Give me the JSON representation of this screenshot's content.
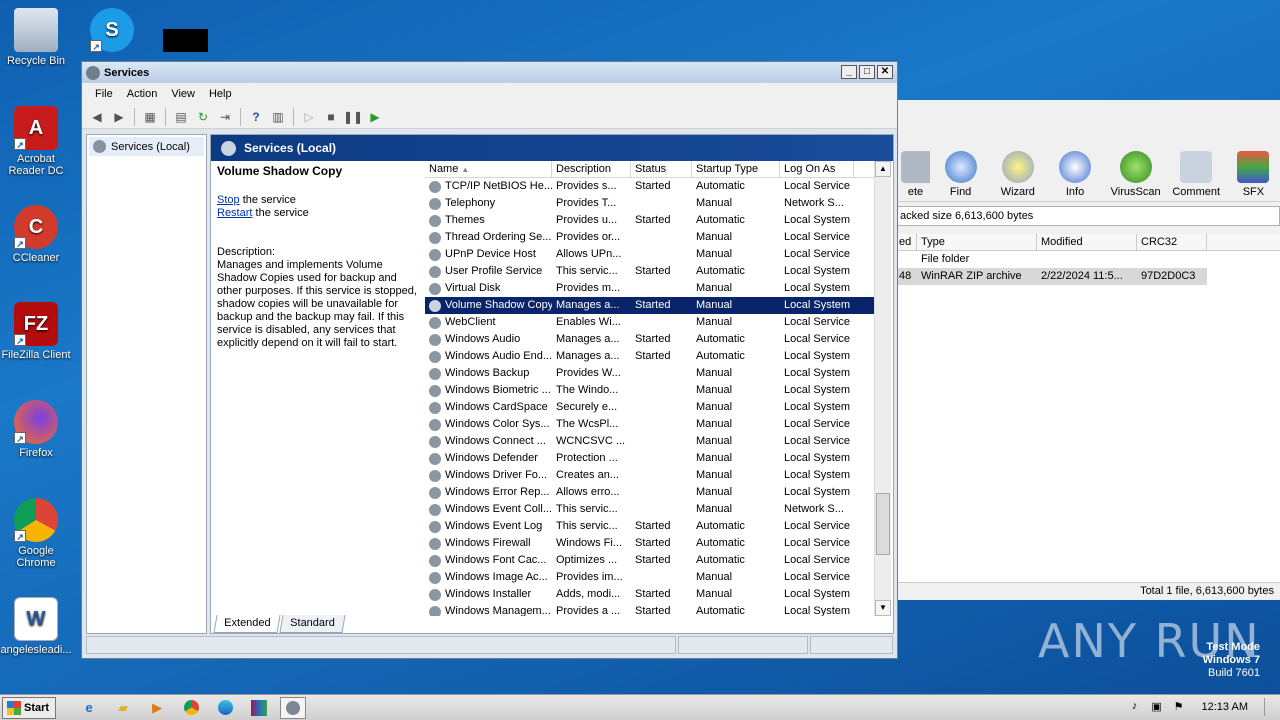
{
  "desktop": {
    "icons": [
      {
        "label": "Recycle Bin",
        "icon": "recycle-bin-icon"
      },
      {
        "label": "Acrobat Reader DC",
        "icon": "acrobat-icon"
      },
      {
        "label": "CCleaner",
        "icon": "ccleaner-icon"
      },
      {
        "label": "FileZilla Client",
        "icon": "filezilla-icon"
      },
      {
        "label": "Firefox",
        "icon": "firefox-icon"
      },
      {
        "label": "Google Chrome",
        "icon": "chrome-icon"
      },
      {
        "label": "angelesleadi...",
        "icon": "word-doc-icon"
      }
    ],
    "skype_icon": "skype-icon",
    "watermark": {
      "line1": "Test Mode",
      "line2": "Windows 7",
      "line3": "Build 7601"
    },
    "anyrun_logo": "ANY RUN"
  },
  "winrar": {
    "tools": [
      {
        "label": "ete",
        "icon": "delete-icon"
      },
      {
        "label": "Find",
        "icon": "find-icon"
      },
      {
        "label": "Wizard",
        "icon": "wizard-icon"
      },
      {
        "label": "Info",
        "icon": "info-icon"
      },
      {
        "label": "VirusScan",
        "icon": "virusscan-icon"
      },
      {
        "label": "Comment",
        "icon": "comment-icon"
      },
      {
        "label": "SFX",
        "icon": "sfx-icon"
      }
    ],
    "path_text": "acked size 6,613,600 bytes",
    "columns": [
      "ed",
      "Type",
      "Modified",
      "CRC32"
    ],
    "rows": [
      {
        "size": "",
        "type": "File folder",
        "modified": "",
        "crc": ""
      },
      {
        "size": "48",
        "type": "WinRAR ZIP archive",
        "modified": "2/22/2024 11:5...",
        "crc": "97D2D0C3"
      }
    ],
    "status": "Total 1 file, 6,613,600 bytes"
  },
  "services": {
    "title": "Services",
    "menu": [
      "File",
      "Action",
      "View",
      "Help"
    ],
    "tree_item": "Services (Local)",
    "pane_title": "Services (Local)",
    "selected_service": "Volume Shadow Copy",
    "stop_link": "Stop",
    "stop_suffix": " the service",
    "restart_link": "Restart",
    "restart_suffix": " the service",
    "desc_label": "Description:",
    "description": "Manages and implements Volume Shadow Copies used for backup and other purposes. If this service is stopped, shadow copies will be unavailable for backup and the backup may fail. If this service is disabled, any services that explicitly depend on it will fail to start.",
    "columns": [
      "Name",
      "Description",
      "Status",
      "Startup Type",
      "Log On As"
    ],
    "rows": [
      [
        "TCP/IP NetBIOS He...",
        "Provides s...",
        "Started",
        "Automatic",
        "Local Service"
      ],
      [
        "Telephony",
        "Provides T...",
        "",
        "Manual",
        "Network S..."
      ],
      [
        "Themes",
        "Provides u...",
        "Started",
        "Automatic",
        "Local System"
      ],
      [
        "Thread Ordering Se...",
        "Provides or...",
        "",
        "Manual",
        "Local Service"
      ],
      [
        "UPnP Device Host",
        "Allows UPn...",
        "",
        "Manual",
        "Local Service"
      ],
      [
        "User Profile Service",
        "This servic...",
        "Started",
        "Automatic",
        "Local System"
      ],
      [
        "Virtual Disk",
        "Provides m...",
        "",
        "Manual",
        "Local System"
      ],
      [
        "Volume Shadow Copy",
        "Manages a...",
        "Started",
        "Manual",
        "Local System"
      ],
      [
        "WebClient",
        "Enables Wi...",
        "",
        "Manual",
        "Local Service"
      ],
      [
        "Windows Audio",
        "Manages a...",
        "Started",
        "Automatic",
        "Local Service"
      ],
      [
        "Windows Audio End...",
        "Manages a...",
        "Started",
        "Automatic",
        "Local System"
      ],
      [
        "Windows Backup",
        "Provides W...",
        "",
        "Manual",
        "Local System"
      ],
      [
        "Windows Biometric ...",
        "The Windo...",
        "",
        "Manual",
        "Local System"
      ],
      [
        "Windows CardSpace",
        "Securely e...",
        "",
        "Manual",
        "Local System"
      ],
      [
        "Windows Color Sys...",
        "The WcsPl...",
        "",
        "Manual",
        "Local Service"
      ],
      [
        "Windows Connect ...",
        "WCNCSVC ...",
        "",
        "Manual",
        "Local Service"
      ],
      [
        "Windows Defender",
        "Protection ...",
        "",
        "Manual",
        "Local System"
      ],
      [
        "Windows Driver Fo...",
        "Creates an...",
        "",
        "Manual",
        "Local System"
      ],
      [
        "Windows Error Rep...",
        "Allows erro...",
        "",
        "Manual",
        "Local System"
      ],
      [
        "Windows Event Coll...",
        "This servic...",
        "",
        "Manual",
        "Network S..."
      ],
      [
        "Windows Event Log",
        "This servic...",
        "Started",
        "Automatic",
        "Local Service"
      ],
      [
        "Windows Firewall",
        "Windows Fi...",
        "Started",
        "Automatic",
        "Local Service"
      ],
      [
        "Windows Font Cac...",
        "Optimizes ...",
        "Started",
        "Automatic",
        "Local Service"
      ],
      [
        "Windows Image Ac...",
        "Provides im...",
        "",
        "Manual",
        "Local Service"
      ],
      [
        "Windows Installer",
        "Adds, modi...",
        "Started",
        "Manual",
        "Local System"
      ],
      [
        "Windows Managem...",
        "Provides a ...",
        "Started",
        "Automatic",
        "Local System"
      ]
    ],
    "selected_index": 7,
    "tabs": [
      "Extended",
      "Standard"
    ]
  },
  "taskbar": {
    "start_label": "Start",
    "apps": [
      "ie-icon",
      "explorer-icon",
      "media-player-icon",
      "chrome-icon",
      "edge-icon",
      "winrar-icon",
      "services-icon"
    ],
    "clock": "12:13 AM"
  }
}
